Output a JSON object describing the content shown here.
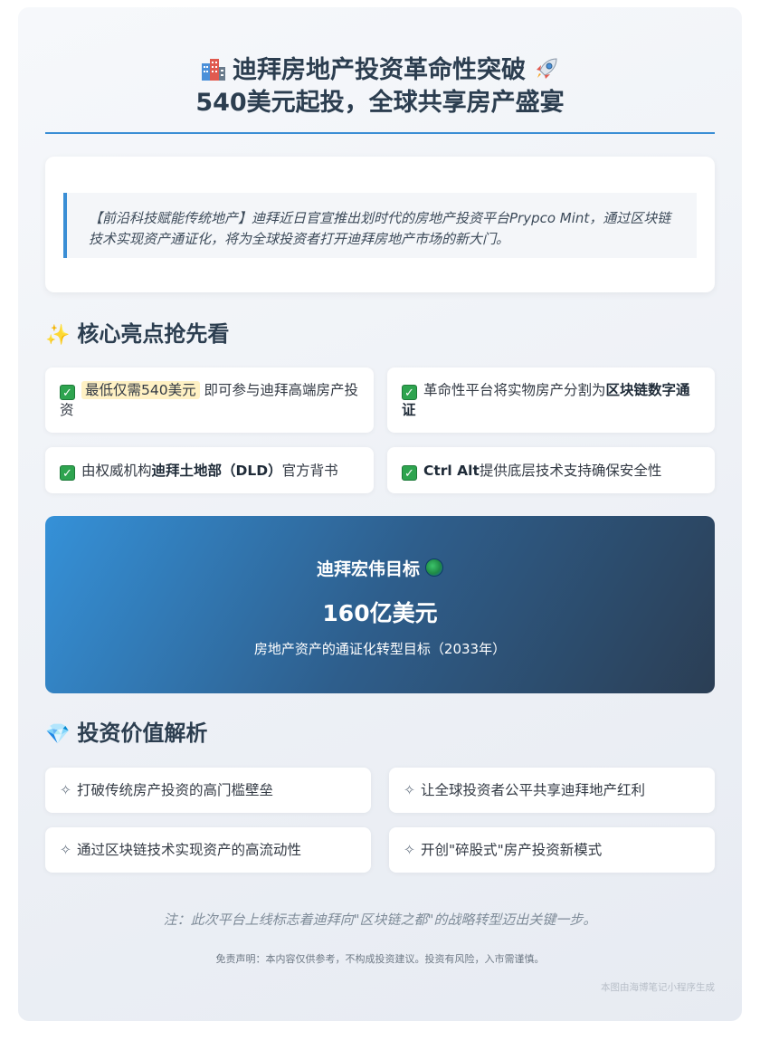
{
  "header": {
    "title_line1": "迪拜房地产投资革命性突破",
    "title_line2": "540美元起投，全球共享房产盛宴"
  },
  "intro": {
    "text": "【前沿科技赋能传统地产】迪拜近日官宣推出划时代的房地产投资平台Prypco Mint，通过区块链技术实现资产通证化，将为全球投资者打开迪拜房地产市场的新大门。"
  },
  "highlights": {
    "heading": "核心亮点抢先看",
    "items": [
      {
        "mark": "最低仅需540美元",
        "rest": "即可参与迪拜高端房产投资"
      },
      {
        "pre": "革命性平台将实物房产分割为",
        "bold": "区块链数字通证"
      },
      {
        "pre": "由权威机构",
        "bold": "迪拜土地部（DLD）",
        "post": "官方背书"
      },
      {
        "bold": "Ctrl Alt",
        "post": "提供底层技术支持确保安全性"
      }
    ]
  },
  "goal": {
    "label": "迪拜宏伟目标",
    "value": "160亿美元",
    "sub": "房地产资产的通证化转型目标（2033年）"
  },
  "value_section": {
    "heading": "投资价值解析",
    "items": [
      "打破传统房产投资的高门槛壁垒",
      "让全球投资者公平共享迪拜地产红利",
      "通过区块链技术实现资产的高流动性",
      "开创\"碎股式\"房产投资新模式"
    ]
  },
  "footer": {
    "note": "注：此次平台上线标志着迪拜向\"区块链之都\"的战略转型迈出关键一步。",
    "disclaimer": "免责声明：本内容仅供参考，不构成投资建议。投资有风险，入市需谨慎。",
    "watermark": "本图由海博笔记小程序生成"
  }
}
